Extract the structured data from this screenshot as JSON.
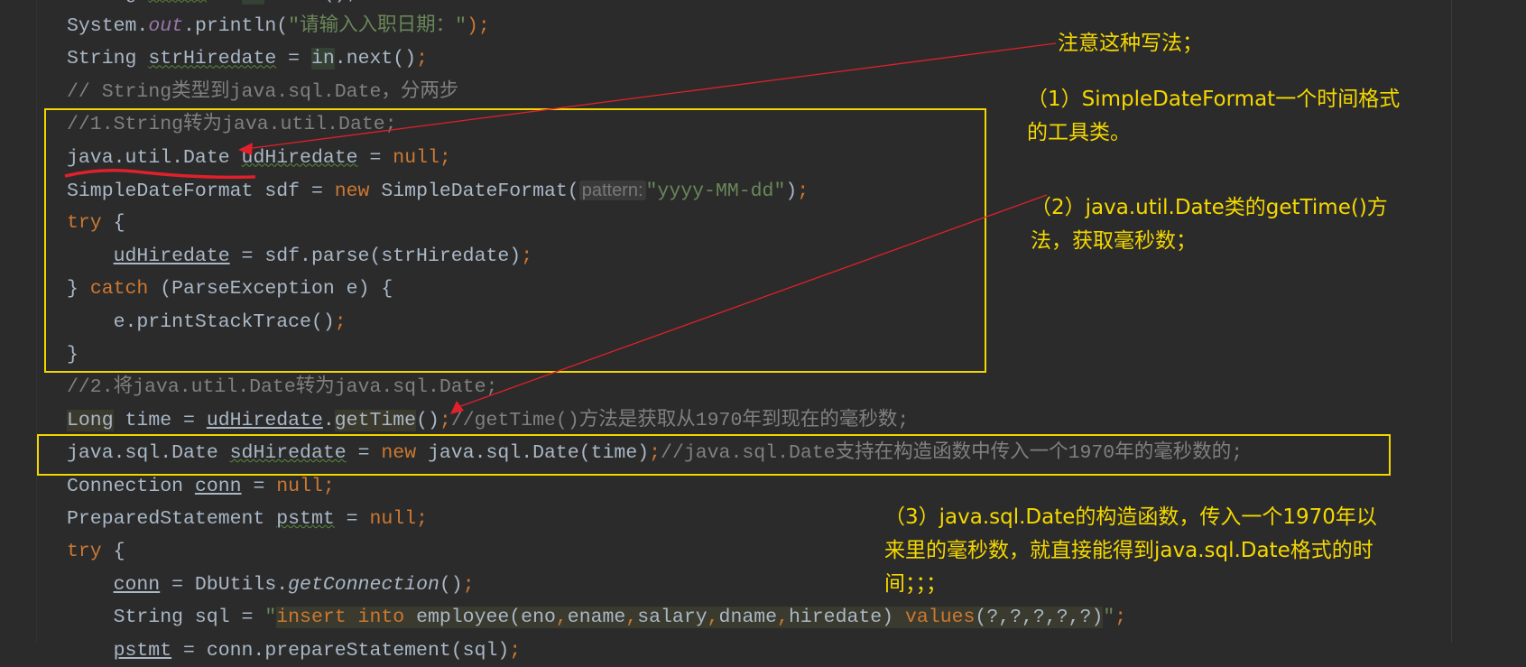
{
  "editor": {
    "lines": [
      {
        "indent": 0,
        "tokens": [
          {
            "t": "String ",
            "c": "p"
          },
          {
            "t": "ename",
            "c": "w"
          },
          {
            "t": " = ",
            "c": "p"
          },
          {
            "t": "in",
            "c": "hg"
          },
          {
            "t": ".next();",
            "c": "p"
          }
        ]
      },
      {
        "indent": 0,
        "tokens": [
          {
            "t": "System.",
            "c": "p"
          },
          {
            "t": "out",
            "c": "st"
          },
          {
            "t": ".println(",
            "c": "p"
          },
          {
            "t": "\"请输入入职日期：\"",
            "c": "s"
          },
          {
            "t": ");",
            "c": "k"
          }
        ]
      },
      {
        "indent": 0,
        "tokens": [
          {
            "t": "String ",
            "c": "p"
          },
          {
            "t": "strHiredate",
            "c": "w"
          },
          {
            "t": " = ",
            "c": "p"
          },
          {
            "t": "in",
            "c": "hg"
          },
          {
            "t": ".next()",
            "c": "p"
          },
          {
            "t": ";",
            "c": "k"
          }
        ]
      },
      {
        "indent": 0,
        "tokens": [
          {
            "t": "// String类型到java.sql.Date，分两步",
            "c": "c"
          }
        ]
      },
      {
        "indent": 0,
        "tokens": [
          {
            "t": "//1.String转为java.util.Date;",
            "c": "c"
          }
        ]
      },
      {
        "indent": 0,
        "tokens": [
          {
            "t": "java.util.Date ",
            "c": "p"
          },
          {
            "t": "udHiredate",
            "c": "w"
          },
          {
            "t": " = ",
            "c": "p"
          },
          {
            "t": "null",
            "c": "k"
          },
          {
            "t": ";",
            "c": "k"
          }
        ]
      },
      {
        "indent": 0,
        "tokens": [
          {
            "t": "SimpleDateFormat sdf = ",
            "c": "p"
          },
          {
            "t": "new ",
            "c": "k"
          },
          {
            "t": "SimpleDateFormat(",
            "c": "p"
          },
          {
            "t": "pattern:",
            "c": "hint"
          },
          {
            "t": "\"yyyy-MM-dd\"",
            "c": "s"
          },
          {
            "t": ")",
            "c": "p"
          },
          {
            "t": ";",
            "c": "k"
          }
        ]
      },
      {
        "indent": 0,
        "tokens": [
          {
            "t": "try ",
            "c": "k"
          },
          {
            "t": "{",
            "c": "p"
          }
        ]
      },
      {
        "indent": 4,
        "tokens": [
          {
            "t": "udHiredate",
            "c": "u"
          },
          {
            "t": " = sdf.parse(strHiredate)",
            "c": "p"
          },
          {
            "t": ";",
            "c": "k"
          }
        ]
      },
      {
        "indent": 0,
        "tokens": [
          {
            "t": "} ",
            "c": "p"
          },
          {
            "t": "catch ",
            "c": "k"
          },
          {
            "t": "(ParseException e) {",
            "c": "p"
          }
        ]
      },
      {
        "indent": 4,
        "tokens": [
          {
            "t": "e.printStackTrace()",
            "c": "p"
          },
          {
            "t": ";",
            "c": "k"
          }
        ]
      },
      {
        "indent": 0,
        "tokens": [
          {
            "t": "}",
            "c": "p"
          }
        ]
      },
      {
        "indent": 0,
        "tokens": [
          {
            "t": "//2.将java.util.Date转为java.sql.Date;",
            "c": "c"
          }
        ]
      },
      {
        "indent": 0,
        "tokens": [
          {
            "t": "Long",
            "c": "hl"
          },
          {
            "t": " time = ",
            "c": "p"
          },
          {
            "t": "udHiredate",
            "c": "u"
          },
          {
            "t": ".",
            "c": "p"
          },
          {
            "t": "getTime",
            "c": "hl"
          },
          {
            "t": "()",
            "c": "p"
          },
          {
            "t": ";",
            "c": "k"
          },
          {
            "t": "//getTime()方法是获取从1970年到现在的毫秒数;",
            "c": "c"
          }
        ]
      },
      {
        "indent": 0,
        "tokens": [
          {
            "t": "java.sql.Date ",
            "c": "p"
          },
          {
            "t": "sdHiredate",
            "c": "w"
          },
          {
            "t": " = ",
            "c": "p"
          },
          {
            "t": "new ",
            "c": "k"
          },
          {
            "t": "java.sql.Date(time)",
            "c": "p"
          },
          {
            "t": ";",
            "c": "k"
          },
          {
            "t": "//java.sql.Date支持在构造函数中传入一个1970年的毫秒数的;",
            "c": "c"
          }
        ]
      },
      {
        "indent": 0,
        "tokens": [
          {
            "t": "Connection ",
            "c": "p"
          },
          {
            "t": "conn",
            "c": "u"
          },
          {
            "t": " = ",
            "c": "p"
          },
          {
            "t": "null",
            "c": "k"
          },
          {
            "t": ";",
            "c": "k"
          }
        ]
      },
      {
        "indent": 0,
        "tokens": [
          {
            "t": "PreparedStatement ",
            "c": "p"
          },
          {
            "t": "pstmt",
            "c": "w"
          },
          {
            "t": " = ",
            "c": "p"
          },
          {
            "t": "null",
            "c": "k"
          },
          {
            "t": ";",
            "c": "k"
          }
        ]
      },
      {
        "indent": 0,
        "tokens": [
          {
            "t": "try ",
            "c": "k"
          },
          {
            "t": "{",
            "c": "p"
          }
        ]
      },
      {
        "indent": 4,
        "tokens": [
          {
            "t": "conn",
            "c": "u"
          },
          {
            "t": " = DbUtils.",
            "c": "p"
          },
          {
            "t": "getConnection",
            "c": "i"
          },
          {
            "t": "()",
            "c": "p"
          },
          {
            "t": ";",
            "c": "k"
          }
        ]
      },
      {
        "indent": 4,
        "tokens": [
          {
            "t": "String sql = ",
            "c": "p"
          },
          {
            "t": "\"",
            "c": "s"
          },
          {
            "t": "insert into ",
            "c": "k sq"
          },
          {
            "t": "employee(eno",
            "c": "p sq"
          },
          {
            "t": ",",
            "c": "k sq"
          },
          {
            "t": "ename",
            "c": "p sq"
          },
          {
            "t": ",",
            "c": "k sq"
          },
          {
            "t": "salary",
            "c": "p sq"
          },
          {
            "t": ",",
            "c": "k sq"
          },
          {
            "t": "dname",
            "c": "p sq"
          },
          {
            "t": ",",
            "c": "k sq"
          },
          {
            "t": "hiredate) ",
            "c": "p sq"
          },
          {
            "t": "values",
            "c": "k sq"
          },
          {
            "t": "(?,?,?,?,?)",
            "c": "p sq"
          },
          {
            "t": "\"",
            "c": "s"
          },
          {
            "t": ";",
            "c": "k"
          }
        ]
      },
      {
        "indent": 4,
        "tokens": [
          {
            "t": "pstmt",
            "c": "u"
          },
          {
            "t": " = conn.prepareStatement(sql)",
            "c": "p"
          },
          {
            "t": ";",
            "c": "k"
          }
        ]
      }
    ]
  },
  "annotations": {
    "note_main": "注意这种写法；",
    "note_1": "（1）SimpleDateFormat一个时间格式\n的工具类。",
    "note_2": "（2）java.util.Date类的getTime()方\n法，获取毫秒数；",
    "note_3": "（3）java.sql.Date的构造函数，传入一个1970年以\n来里的毫秒数，就直接能得到java.sql.Date格式的时\n间；；；"
  },
  "colors": {
    "background": "#2b2b2b",
    "annotation": "#f5d800",
    "box": "#f2d600",
    "arrow": "#e0202a"
  }
}
